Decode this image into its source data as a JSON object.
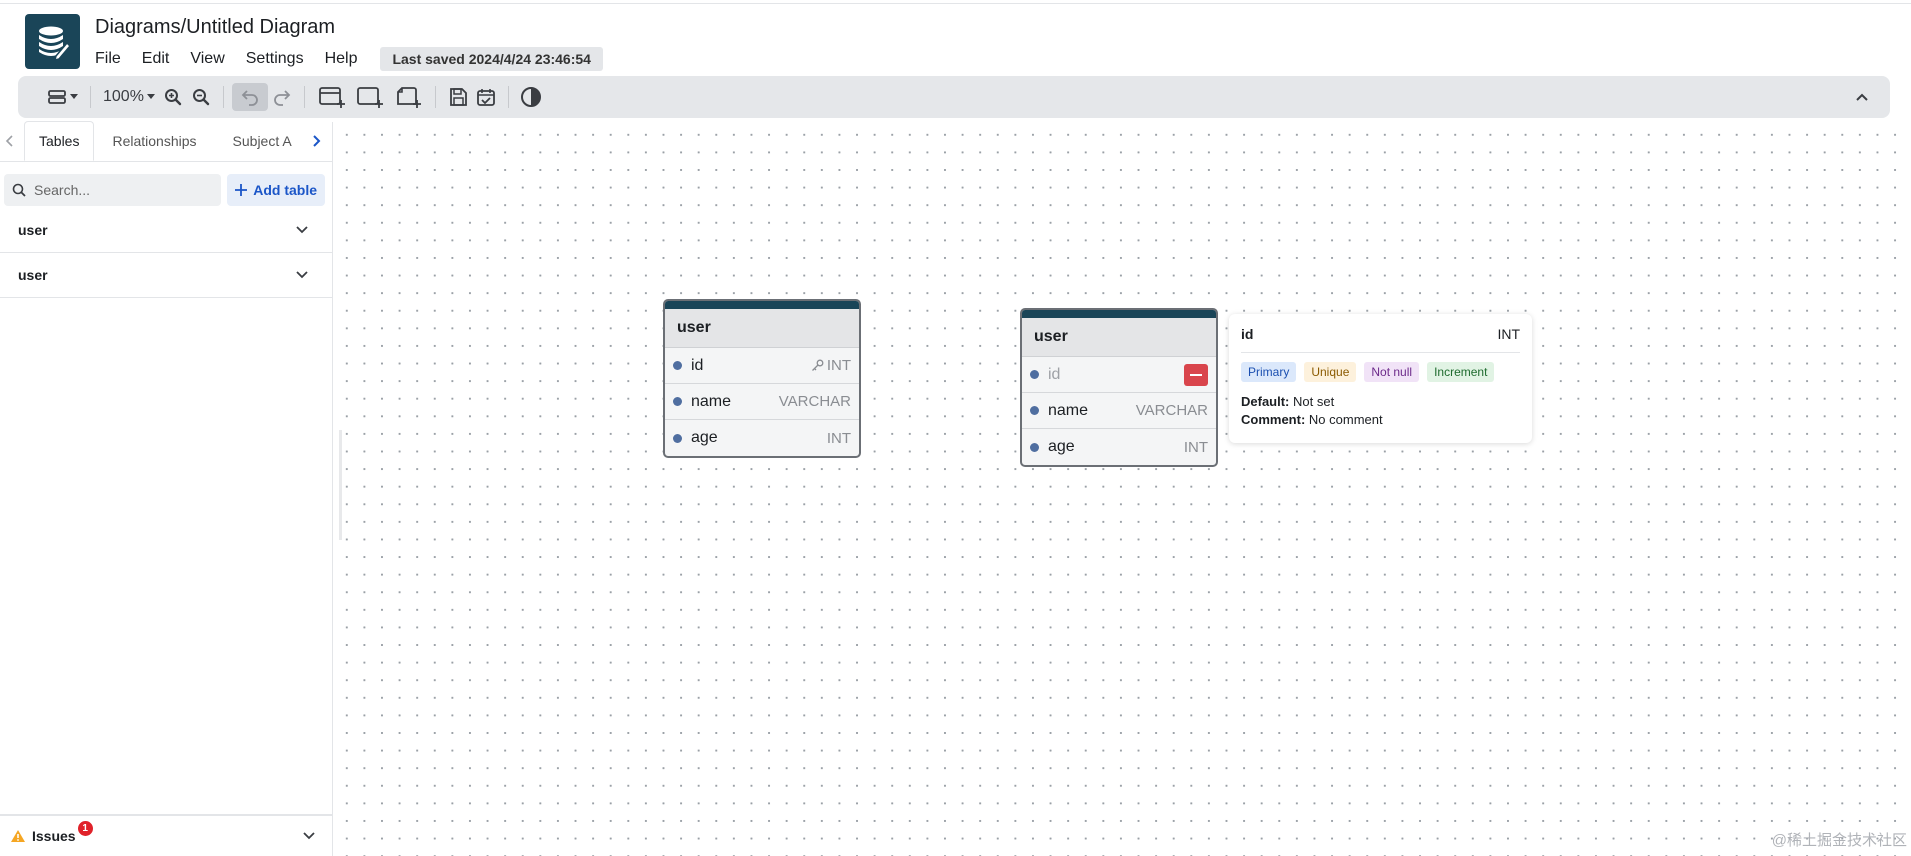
{
  "header": {
    "title": "Diagrams/Untitled Diagram",
    "menu": [
      "File",
      "Edit",
      "View",
      "Settings",
      "Help"
    ],
    "last_saved": "Last saved 2024/4/24 23:46:54"
  },
  "toolbar": {
    "zoom": "100%",
    "icons": [
      "layout-icon",
      "zoom-in-icon",
      "zoom-out-icon",
      "undo-icon",
      "redo-icon",
      "add-table-icon",
      "add-area-icon",
      "add-note-icon",
      "save-icon",
      "todo-icon",
      "theme-icon",
      "collapse-icon"
    ]
  },
  "sidebar": {
    "tabs": [
      "Tables",
      "Relationships",
      "Subject A"
    ],
    "active_tab": "Tables",
    "search_placeholder": "Search...",
    "add_table_label": "Add table",
    "tables": [
      {
        "label": "user"
      },
      {
        "label": "user"
      }
    ],
    "issues_label": "Issues",
    "issues_count": "1"
  },
  "canvas": {
    "tables": [
      {
        "name": "user",
        "fields": [
          {
            "name": "id",
            "type": "INT",
            "primary_key": true
          },
          {
            "name": "name",
            "type": "VARCHAR"
          },
          {
            "name": "age",
            "type": "INT"
          }
        ]
      },
      {
        "name": "user",
        "fields": [
          {
            "name": "id",
            "type": "INT",
            "hovered": true
          },
          {
            "name": "name",
            "type": "VARCHAR"
          },
          {
            "name": "age",
            "type": "INT"
          }
        ]
      }
    ],
    "popover": {
      "field": "id",
      "type": "INT",
      "tags": [
        {
          "label": "Primary",
          "bg": "#dbe8fb",
          "fg": "#1b4fb0"
        },
        {
          "label": "Unique",
          "bg": "#fdf1dc",
          "fg": "#8a5a00"
        },
        {
          "label": "Not null",
          "bg": "#f1e3f7",
          "fg": "#6c2a8a"
        },
        {
          "label": "Increment",
          "bg": "#e1f3e4",
          "fg": "#1e6b2e"
        }
      ],
      "default_label": "Default:",
      "default_value": "Not set",
      "comment_label": "Comment:",
      "comment_value": "No comment"
    }
  },
  "watermark": "@稀土掘金技术社区",
  "colors": {
    "accent": "#1a4558",
    "primary_blue": "#1b56c8",
    "danger": "#d9454c"
  }
}
